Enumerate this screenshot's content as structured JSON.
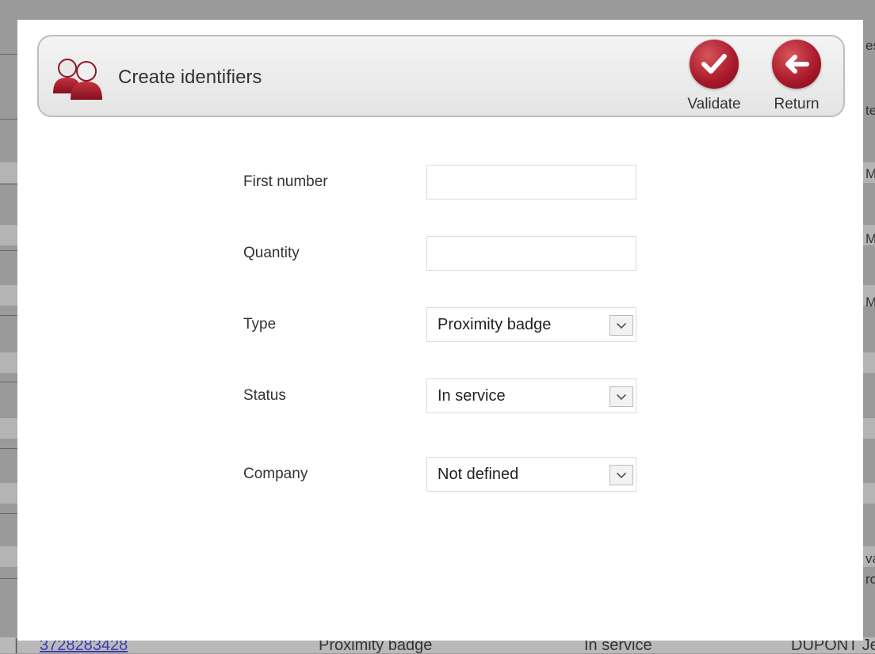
{
  "header": {
    "title": "Create identifiers",
    "validate_label": "Validate",
    "return_label": "Return",
    "accent_color": "#a7182a"
  },
  "form": {
    "first_number": {
      "label": "First number",
      "value": ""
    },
    "quantity": {
      "label": "Quantity",
      "value": ""
    },
    "type": {
      "label": "Type",
      "value": "Proximity badge"
    },
    "status": {
      "label": "Status",
      "value": "In service"
    },
    "company": {
      "label": "Company",
      "value": "Not defined"
    }
  },
  "background": {
    "right_fragments": [
      "es",
      "te",
      "Mo",
      "Mo",
      "Mo",
      "va",
      "ro"
    ],
    "bottom_row": {
      "number": "3728283428",
      "type": "Proximity badge",
      "status": "In service",
      "name": "DUPONT Je"
    }
  },
  "icons": {
    "header": "users-icon",
    "validate": "checkmark-icon",
    "return": "arrow-left-icon",
    "dropdown": "chevron-down-icon"
  }
}
